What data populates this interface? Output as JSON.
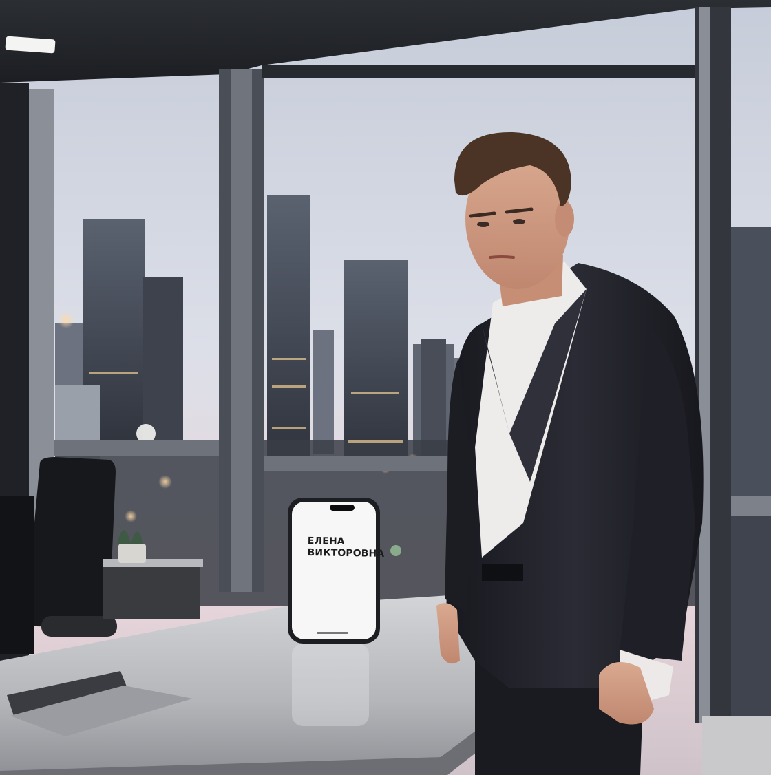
{
  "phone": {
    "caller_name": "ЕЛЕНА ВИКТОРОВНА"
  },
  "colors": {
    "sky_top": "#c9cfdc",
    "sky_mid": "#dde0ea",
    "sky_horizon": "#e8d6dd",
    "frame_dark": "#2a2d33",
    "desk_surface": "#b7b9bd",
    "suit": "#22232b",
    "shirt": "#eceaea",
    "phone_screen": "#f7f7f7"
  }
}
